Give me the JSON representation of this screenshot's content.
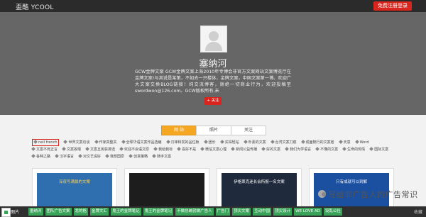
{
  "header": {
    "logo": "歪酷 YCOOL",
    "register_button": "免费注册登录"
  },
  "profile": {
    "name": "塞纳河",
    "description": "GCW金牌文案 GCW金牌文案上海2010年专博会非官方文案网站文案博览厅在金牌文案!与其说是某策，不如去一只楼体，金牌文案，中国文案第一博。欢迎广大文案交换BLOG链接！纯交流博客，谢绝一切商业行为，欢迎投稿至swordwon@126.com。GCW版权所有,未",
    "follow_button": "+ 关注"
  },
  "tabs": [
    {
      "label": "网 站",
      "active": true
    },
    {
      "label": "照片",
      "active": false
    },
    {
      "label": "关注",
      "active": false
    }
  ],
  "tags": [
    "neil french",
    "世界文案访谈",
    "作家真整实",
    "全球华语文案作品选编",
    "刃锋转发的品位板",
    "团长",
    "买得轻站",
    "朴素的文案",
    "台湾文案刀痕",
    "成面随行的文案者",
    "天意",
    "Word",
    "文案不死正言",
    "文案故端",
    "文案五房获排选",
    "欢迎不会语文原",
    "我给我标",
    "喜好不是",
    "微信文案心理",
    "新闻公益传播",
    "好的文案",
    "我们为学语言",
    "不懂的文案",
    "生命的热情",
    "国际文案",
    "各种之路",
    "汉字语言",
    "对文艺说好",
    "我想国原",
    "创意策略",
    "随手文案"
  ],
  "cards": [
    {
      "caption": "深夜写满晨的文案",
      "color": "#2f6fb0"
    },
    {
      "caption": "",
      "color": "#1d1d1d"
    },
    {
      "caption": "伊格莱克迷长会所报一名文案",
      "color": "#1f2a3d"
    },
    {
      "caption": "只有成就可以到解",
      "color": "#1b4fa0"
    }
  ],
  "footer": {
    "app_label": "图片",
    "links": [
      {
        "label": "墨纳河",
        "color": "#3aa35a"
      },
      {
        "label": "团队广告文案",
        "color": "#3aa35a"
      },
      {
        "label": "龙的格",
        "color": "#3aa35a"
      },
      {
        "label": "金牌文汇",
        "color": "#3aa35a"
      },
      {
        "label": "鬼王的金牌笔记",
        "color": "#3aa35a"
      },
      {
        "label": "鬼王的金牌笔记",
        "color": "#3aa35a"
      },
      {
        "label": "不做总统就做广告人",
        "color": "#3aa35a"
      },
      {
        "label": "广告门",
        "color": "#3aa35a"
      },
      {
        "label": "顶尖文案",
        "color": "#3aa35a"
      },
      {
        "label": "互动中国",
        "color": "#3aa35a"
      },
      {
        "label": "顶尖设计",
        "color": "#3aa35a"
      },
      {
        "label": "WE LOVE AD",
        "color": "#3aa35a"
      },
      {
        "label": "设乱公社",
        "color": "#3aa35a"
      }
    ],
    "right_label": "收藏"
  },
  "watermark": "写给非广告人的广告常识",
  "colors": {
    "accent_red": "#d9251d",
    "tab_active": "#f5a623",
    "hero_bg": "#666666"
  }
}
